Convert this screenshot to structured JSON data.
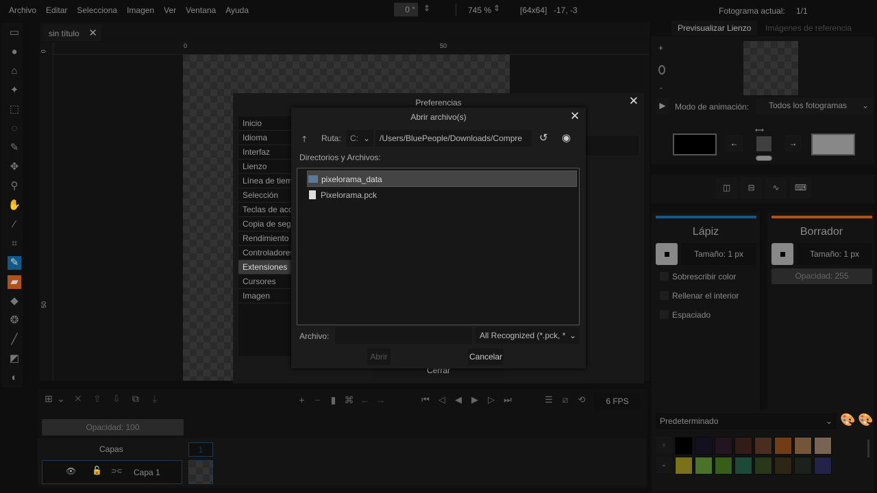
{
  "menu": [
    "Archivo",
    "Editar",
    "Selecciona",
    "Imagen",
    "Ver",
    "Ventana",
    "Ayuda"
  ],
  "topbar": {
    "rotation": "0 °",
    "zoom": "745 %",
    "size": "[64x64]",
    "coords": "-17, -3",
    "frame_label": "Fotograma actual:",
    "frame_value": "1/1"
  },
  "tab": {
    "title": "sin título"
  },
  "ruler": {
    "h0": "0",
    "h50": "50",
    "v0": "0",
    "v50": "50"
  },
  "preferences": {
    "title": "Preferencias",
    "items": [
      "Inicio",
      "Idioma",
      "Interfaz",
      "Lienzo",
      "Línea de tiempo",
      "Selección",
      "Teclas de acceso",
      "Copia de seguridad",
      "Rendimiento",
      "Controladores",
      "Extensiones",
      "Cursores",
      "Imagen"
    ],
    "selected": "Extensiones",
    "close": "Cerrar"
  },
  "file_dialog": {
    "title": "Abrir archivo(s)",
    "path_label": "Ruta:",
    "drive": "C:",
    "path": "/Users/BluePeople/Downloads/Compre",
    "list_label": "Directorios y Archivos:",
    "entries": [
      {
        "name": "pixelorama_data",
        "type": "folder"
      },
      {
        "name": "Pixelorama.pck",
        "type": "file"
      }
    ],
    "file_label": "Archivo:",
    "file_value": "",
    "filter": "All Recognized (*.pck, *",
    "open": "Abrir",
    "cancel": "Cancelar"
  },
  "right": {
    "tab_preview": "Previsualizar Lienzo",
    "tab_refs": "Imágenes de referencia",
    "zoom_plus": "+",
    "zoom_minus": "-",
    "anim_label": "Modo de animación:",
    "anim_value": "Todos los fotogramas",
    "left_tool": {
      "name": "Lápiz",
      "size": "Tamaño: 1 px",
      "color": "#0f5a8a",
      "options": [
        "Sobrescribir color",
        "Rellenar el interior",
        "Espaciado"
      ]
    },
    "right_tool": {
      "name": "Borrador",
      "size": "Tamaño: 1 px",
      "opacity": "Opacidad: 255",
      "color": "#b0501a"
    },
    "palette": {
      "name": "Predeterminado",
      "add": "+",
      "remove": "-",
      "colors": [
        "#000000",
        "#13111f",
        "#221520",
        "#331c18",
        "#4a2d20",
        "#733c15",
        "#735538",
        "#7a6352",
        "#7a7118",
        "#4a7228",
        "#365e18",
        "#1d4a38",
        "#29381a",
        "#2e2614",
        "#1c211e",
        "#23234a"
      ]
    }
  },
  "timeline": {
    "opacity": "Opacidad: 100",
    "layers_label": "Capas",
    "frame_number": "1",
    "layer_name": "Capa 1",
    "fps": "6 FPS"
  }
}
